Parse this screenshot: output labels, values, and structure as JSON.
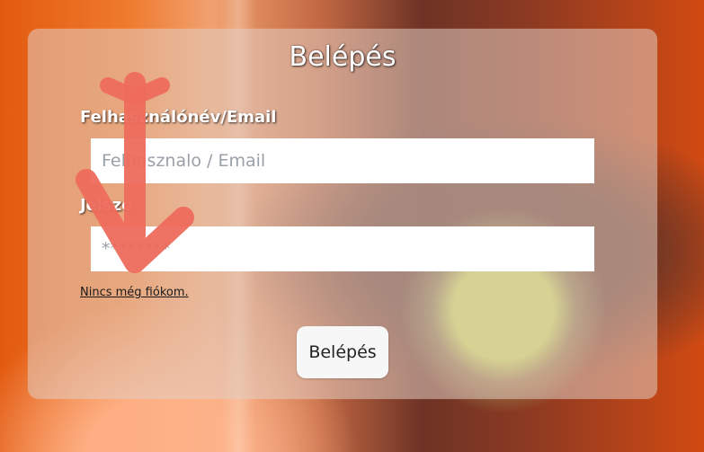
{
  "login": {
    "title": "Belépés",
    "username_label": "Felhasználónév/Email",
    "username_placeholder": "Felhasznalo / Email",
    "password_label": "Jelszó",
    "password_placeholder": "********",
    "register_link": "Nincs még fiókom.",
    "submit_label": "Belépés"
  },
  "annotation": {
    "type": "arrow-down-icon",
    "color": "#ee6c5c"
  },
  "colors": {
    "card_bg": "rgba(225,205,195,0.55)",
    "button_bg": "#f7f7f7",
    "text_light": "#ffffff"
  }
}
